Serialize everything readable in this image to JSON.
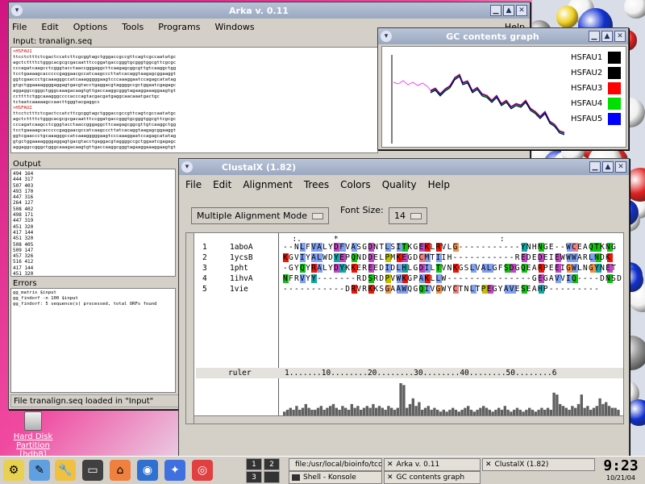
{
  "desktop": {
    "drive_label_1": "Hard Disk",
    "drive_label_2": "Partition [hdb8]"
  },
  "arka": {
    "title": "Arka v. 0.11",
    "menu": [
      "File",
      "Edit",
      "Options",
      "Tools",
      "Programs",
      "Windows",
      "Help"
    ],
    "input_label": "Input: tranalign.seq",
    "output_label": "Output",
    "errors_label": "Errors",
    "status": "File tranalign.seq loaded in \"Input\"",
    "input_lines": [
      ">HSFAU1",
      "ttcctctttctcgactccatcttcgcggtagctgggaccgccgttcagtcgccaatatgc",
      "agctcttttctgggcacgcgcgacaatttccggatgaccgggtgcgggtggcgttcgcgc",
      "cccagatcaagcctcgggtacctaaccgggaggcttcaagagcggcgttgtcaaggctgg",
      "tcctgaaaagcacccccgaggaacgccatcaagcccttatcacaggtaagagcggaaggt",
      "ggtcgaaccctgcaaagggccatcaaagggggaagtcccaaaggaatccagagcatatag",
      "gtgctggaaaaggggaggagtgacgtacctgaggacgtaggggccgctggaatcgagagc",
      "aggaggccgggctgggcaaagacaagtgttgaccaaggcgggtagaaggaaaggaagtgt",
      "ccttttctggcaaagggccccacccagtacgacgatgaggcaacaaatgactgc",
      "tctaatcaaaaagccaacttgggtacgaggcc",
      ">HSFAU2",
      "ttcctctttctcgactccatcttcgcggtagctgggaccgccgttcagtcgccaatatgc",
      "agctcttttctgggcacgcgcgacaatttccggatgaccgggtgcgggtggcgttcgcgc",
      "cccagatcaagcctcgggtacctaaccgggaggcttcaagagcggcgttgtcaaggctgg",
      "tcctgaaaagcacccccgaggaacgccatcaagcccttatcacaggtaagagcggaaggt",
      "ggtcgaaccctgcaaagggccatcaaagggggaagtcccaaaggaatccagagcatatag",
      "gtgctggaaaaggggaggagtgacgtacctgaggacgtaggggccgctggaatcgagagc",
      "aggaggccgggctgggcaaagacaagtgttgaccaaggcgggtagaaggaaaggaagtgt"
    ],
    "output_lines": [
      "494 164",
      "444 317",
      "507 403",
      "493 170",
      "447 316",
      "264 127",
      "508 402",
      "498 171",
      "447 319",
      "451 320",
      "417 144",
      "451 320",
      "508 405",
      "509 147",
      "457 326",
      "516 412",
      "417 144",
      "451 320",
      "451 320",
      "518 405"
    ],
    "error_lines": [
      "gg_matrix  $input",
      "gg_findorf -n 100  $input",
      "gg_findorf: 5 sequence(s) processed, total ORFs found"
    ]
  },
  "gc_graph": {
    "title": "GC contents graph",
    "legend": [
      {
        "name": "HSFAU1",
        "color": "#000000"
      },
      {
        "name": "HSFAU2",
        "color": "#000000"
      },
      {
        "name": "HSFAU3",
        "color": "#ff0000"
      },
      {
        "name": "HSFAU4",
        "color": "#00e000"
      },
      {
        "name": "HSFAU5",
        "color": "#0000ff"
      }
    ]
  },
  "clustal": {
    "title": "ClustalX (1.82)",
    "menu": [
      "File",
      "Edit",
      "Alignment",
      "Trees",
      "Colors",
      "Quality",
      "Help"
    ],
    "mode": "Multiple Alignment Mode",
    "font_size_label": "Font Size:",
    "font_size": "14",
    "consensus_marks": "  :.       *                                   :",
    "sequences": [
      {
        "num": "1",
        "name": "1aboA",
        "seq": "--NLFVALYDFVASGDNTLSITKGEKLRVLG-----------YNHNGE--WCEAQTKNG"
      },
      {
        "num": "2",
        "name": "1ycsB",
        "seq": "KGVIYALWDYEPQNDDELPMKEGDCMTIIH-----------REDEDEIEWWWARLNDK"
      },
      {
        "num": "3",
        "name": "1pht",
        "seq": "-GYQYRALYDYKKEREEDIDLHLGDILTVNKGSLVALGFSDGQEARPEEIGWLNGYNET"
      },
      {
        "num": "4",
        "name": "1ihvA",
        "seq": "NFRVYY-------RDSRDPVWKGPAKLLW---------------GEGAVVIQ----DNSD"
      },
      {
        "num": "5",
        "name": "1vie",
        "seq": "-----------DRVRKKSGAAWQGQIVGWYCTNLTPEGYAVESEAHP---------"
      }
    ],
    "ruler_label": "ruler",
    "ruler": "1.......10........20........30........40........50........6",
    "quality_bars": [
      2,
      3,
      4,
      3,
      5,
      3,
      4,
      6,
      4,
      3,
      3,
      4,
      5,
      3,
      4,
      5,
      6,
      4,
      3,
      5,
      4,
      3,
      6,
      4,
      5,
      3,
      4,
      5,
      4,
      6,
      4,
      5,
      4,
      3,
      5,
      4,
      3,
      4,
      17,
      16,
      4,
      6,
      9,
      5,
      7,
      3,
      4,
      5,
      3,
      4,
      3,
      2,
      3,
      2,
      3,
      4,
      3,
      2,
      3,
      4,
      5,
      3,
      2,
      3,
      4,
      5,
      4,
      3,
      2,
      3,
      4,
      3,
      5,
      3,
      2,
      3,
      4,
      3,
      2,
      3,
      4,
      3,
      2,
      3,
      4,
      3,
      4,
      3,
      12,
      11,
      6,
      5,
      4,
      3,
      5,
      4,
      6,
      11,
      4,
      5,
      3,
      4,
      5,
      9,
      6,
      7,
      5,
      4,
      4,
      3
    ]
  },
  "taskbar": {
    "pager": [
      "1",
      "2",
      "3",
      "4"
    ],
    "tasks": [
      "file:/usr/local/bioinfo/tcoffee",
      "Arka v. 0.11",
      "ClustalX (1.82)",
      "Shell - Konsole",
      "GC contents graph"
    ],
    "time": "9:23",
    "date": "10/21/04"
  }
}
